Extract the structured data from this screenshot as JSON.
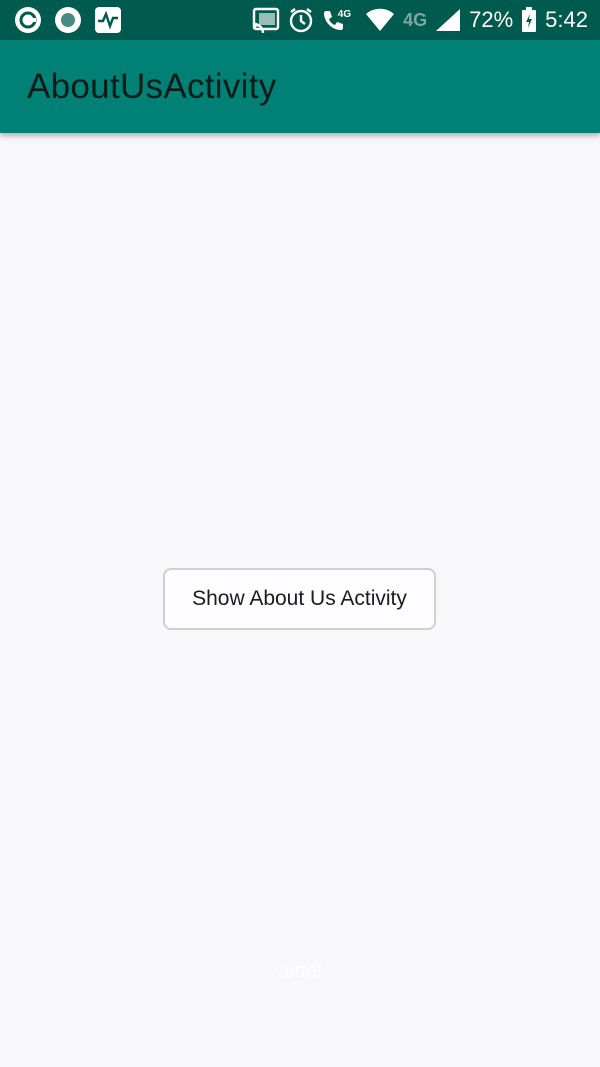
{
  "status_bar": {
    "battery": "72%",
    "time": "5:42",
    "network_small": "4G",
    "network_large": "4G",
    "icons": [
      "app-circle-icon",
      "record-icon",
      "activity-monitor-icon",
      "cast-icon",
      "alarm-icon",
      "volte-call-icon",
      "wifi-icon",
      "signal-icon",
      "battery-charging-icon"
    ],
    "background": "#015a4e"
  },
  "app_bar": {
    "title": "AboutUsActivity",
    "background": "#018175"
  },
  "main": {
    "button_label": "Show About Us Activity",
    "background": "#f8f7fa"
  },
  "carrier": {
    "label": "airtel"
  }
}
